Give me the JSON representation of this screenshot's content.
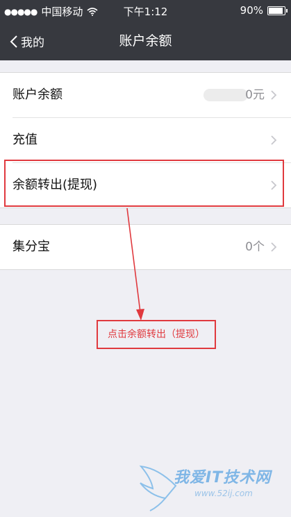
{
  "status": {
    "signal_dots": "●●●●●",
    "carrier": "中国移动",
    "time": "下午1:12",
    "battery_text": "90%",
    "battery_level": 0.9
  },
  "nav": {
    "back_label": "我的",
    "title": "账户余额"
  },
  "rows": [
    {
      "label": "账户余额",
      "value": "0元"
    },
    {
      "label": "充值",
      "value": ""
    },
    {
      "label": "余额转出(提现)",
      "value": ""
    }
  ],
  "rows2": [
    {
      "label": "集分宝",
      "value": "0个"
    }
  ],
  "annotation": {
    "text": "点击余额转出（提现）",
    "color": "#e0393e"
  },
  "watermark": {
    "text": "我爱IT技术网",
    "url": "www.52ij.com"
  }
}
